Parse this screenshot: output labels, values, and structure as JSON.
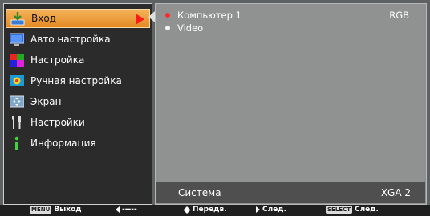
{
  "menu": {
    "items": [
      {
        "label": "Вход",
        "icon": "input-arrow-icon",
        "active": true
      },
      {
        "label": "Авто настройка",
        "icon": "auto-setup-icon"
      },
      {
        "label": "Настройка",
        "icon": "image-adjust-icon"
      },
      {
        "label": "Ручная настройка",
        "icon": "manual-adjust-icon"
      },
      {
        "label": "Экран",
        "icon": "screen-icon"
      },
      {
        "label": "Настройки",
        "icon": "tools-icon"
      },
      {
        "label": "Информация",
        "icon": "info-icon"
      }
    ]
  },
  "sources": [
    {
      "label": "Компьютер 1",
      "type": "RGB",
      "selected": true
    },
    {
      "label": "Video",
      "type": "",
      "selected": false
    }
  ],
  "system": {
    "label": "Система",
    "value": "XGA 2"
  },
  "footer": {
    "menu_key": "MENU",
    "exit_label": "Выход",
    "back_label": "-----",
    "move_label": "Передв.",
    "next_label": "След.",
    "select_key": "SELECT",
    "select_label": "След."
  },
  "colors": {
    "accent": "#e48a22",
    "selected_dot": "#ff2a2a",
    "arrow": "#ff1a1a"
  }
}
